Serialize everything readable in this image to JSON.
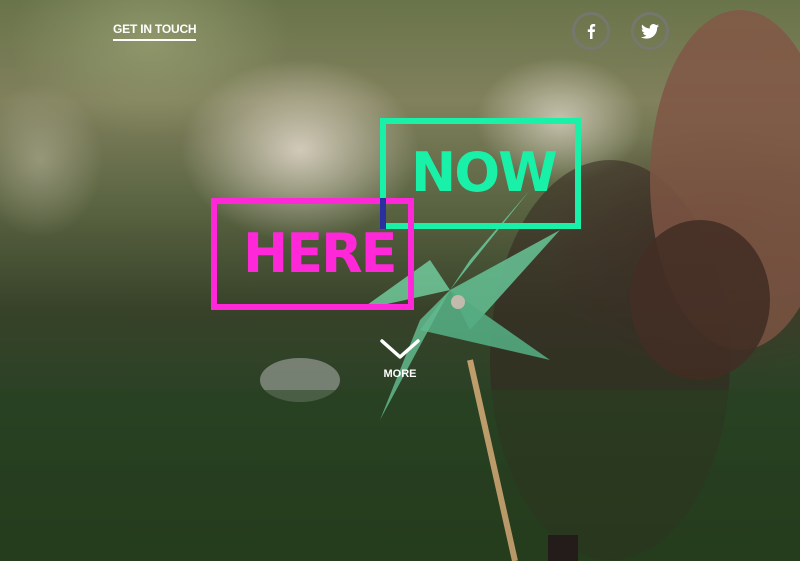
{
  "header": {
    "contact_link": "GET IN TOUCH",
    "social": [
      {
        "icon": "facebook-icon",
        "glyph": "f"
      },
      {
        "icon": "twitter-icon",
        "glyph": ""
      }
    ]
  },
  "hero": {
    "word_top": "NOW",
    "word_bottom": "HERE",
    "accent_top": "#19f0a8",
    "accent_bottom": "#ff28d8",
    "more_label": "MORE"
  }
}
